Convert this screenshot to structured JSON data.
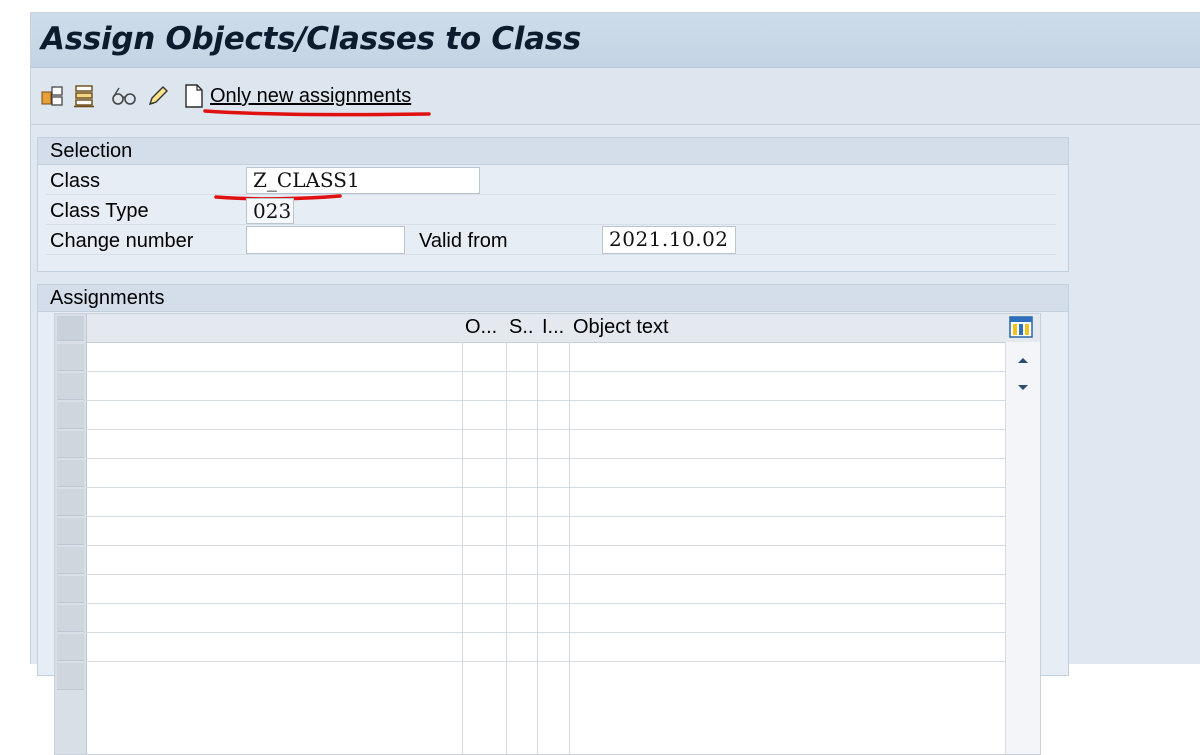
{
  "window": {
    "title": "Assign Objects/Classes to Class"
  },
  "toolbar": {
    "icons": [
      "assign-icon",
      "hierarchy-icon",
      "glasses-display-icon",
      "pencil-change-icon",
      "new-document-icon"
    ],
    "only_new_label": "Only new assignments"
  },
  "selection": {
    "title": "Selection",
    "class_label": "Class",
    "class_value": "Z_CLASS1",
    "class_type_label": "Class Type",
    "class_type_value": "023",
    "change_number_label": "Change number",
    "change_number_value": "",
    "valid_from_label": "Valid from",
    "valid_from_value": "2021.10.02"
  },
  "assignments": {
    "title": "Assignments",
    "columns": [
      "O...",
      "S..",
      "I...",
      "Object text"
    ],
    "rows": []
  },
  "colors": {
    "annotation": "#e01010",
    "title_bar": "#c8d8e8"
  }
}
